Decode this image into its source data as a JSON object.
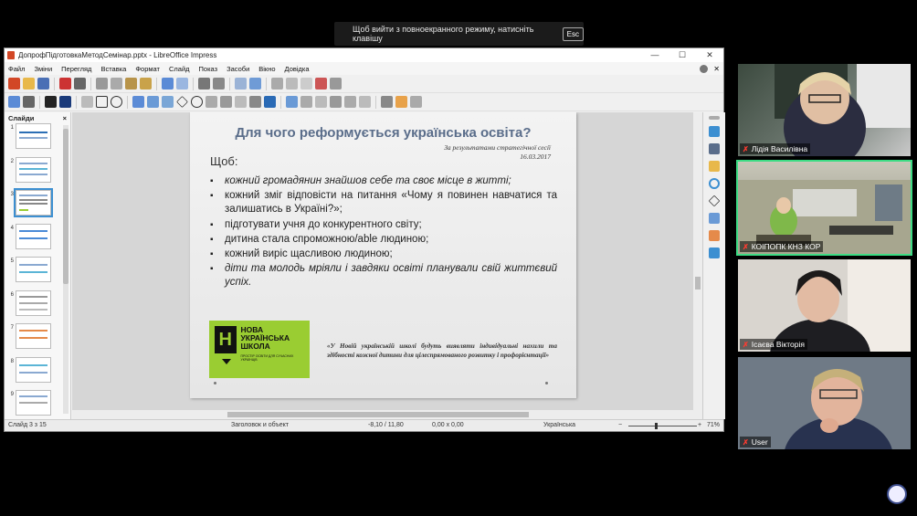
{
  "fullscreen_banner": {
    "text": "Щоб вийти з повноекранного режиму, натисніть клавішу",
    "key": "Esc"
  },
  "window": {
    "title": "ДопрофПідготовкаМетодСемінар.pptx - LibreOffice Impress",
    "minimize": "—",
    "maximize": "☐",
    "close": "✕"
  },
  "menu": [
    "Файл",
    "Зміни",
    "Перегляд",
    "Вставка",
    "Формат",
    "Слайд",
    "Показ",
    "Засоби",
    "Вікно",
    "Довідка"
  ],
  "slide_pane": {
    "header": "Слайди",
    "close": "×",
    "thumbnails": [
      "1",
      "2",
      "3",
      "4",
      "5",
      "6",
      "7",
      "8",
      "9"
    ],
    "selected_index": 3
  },
  "slide": {
    "title": "Для чого реформується українська освіта?",
    "subtitle_line1": "За результатами стратегічної сесії",
    "subtitle_line2": "16.03.2017",
    "intro": "Щоб:",
    "bullets": [
      "кожний громадянин знайшов себе та своє місце в житті;",
      "кожний зміг відповісти на питання «Чому я повинен навчатися та залишатись в Україні?»;",
      "підготувати учня до конкурентного світу;",
      "дитина стала спроможною/able людиною;",
      "кожний виріс щасливою людиною;",
      "діти та молодь мріяли і завдяки освіті планували свій життєвий успіх."
    ],
    "logo_mark": "Н",
    "logo_line1": "НОВА",
    "logo_line2": "УКРАЇНСЬКА",
    "logo_line3": "ШКОЛА",
    "logo_small": "ПРОСТІР ОСВІТИ ДЛЯ СУЧАСНИХ УКРАЇНЦІВ",
    "quote": "«У Новій українській школі будуть виявляти індивідуальні нахили та здібності кожної дитини для цілеспрямованого розвитку і профорієнтації»"
  },
  "statusbar": {
    "slide_count": "Слайд 3 з 15",
    "layout": "Заголовок и объект",
    "position": "-8,10 / 11,80",
    "size": "0,00 x 0,00",
    "language": "Українська",
    "zoom": "71%",
    "zoom_minus": "−",
    "zoom_plus": "+"
  },
  "participants": [
    {
      "name": "Лідія Василівна",
      "muted": true
    },
    {
      "name": "КОІПОПК КНЗ КОР",
      "muted": true
    },
    {
      "name": "Ісаєва Вікторія",
      "muted": true
    },
    {
      "name": "User",
      "muted": true
    }
  ],
  "colors": {
    "slide_title": "#5a6d8a",
    "logo_green": "#9acd32",
    "active_speaker": "#3ddc84",
    "muted_icon": "#ff3b30"
  }
}
